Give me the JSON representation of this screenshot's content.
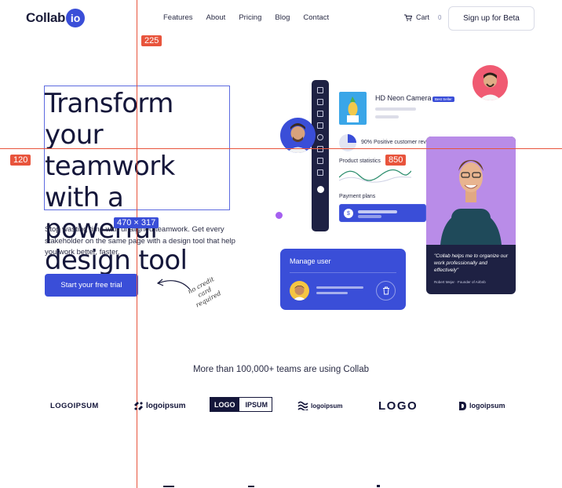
{
  "brand": {
    "name": "Collab",
    "badge": "io",
    "accent": "#3a4ed8"
  },
  "nav": {
    "items": [
      "Features",
      "About",
      "Pricing",
      "Blog",
      "Contact"
    ]
  },
  "cart": {
    "label": "Cart",
    "count": "0"
  },
  "signup_label": "Sign up for Beta",
  "guides": {
    "x_label": "225",
    "y_label": "120",
    "size_label": "470 × 317",
    "chart_label": "850"
  },
  "hero": {
    "title": "Transform your teamwork with a powerful design tool",
    "subtitle": "Stop wasting time with unaligned teamwork. Get every stakeholder on the same page with a design tool that help you work better, faster.",
    "cta": "Start your free trial",
    "note": "no credit card required"
  },
  "product": {
    "title": "HD Neon Camera",
    "badge": "Best Seller",
    "positive": "90% Positive customer rev",
    "stats": "Product statistics",
    "payment": "Payment plans",
    "payment_icon": "$"
  },
  "testimonial": {
    "quote": "\"Collab helps me to organize our work professionally and effectively\"",
    "author": "Robert Mejar",
    "role": "Founder of Airbnb"
  },
  "manage": {
    "title": "Manage user"
  },
  "trusted": "More than 100,000+ teams are using Collab",
  "logos": {
    "l1": "LOGOIPSUM",
    "l2": "logoipsum",
    "l3a": "LOGO",
    "l3b": "IPSUM",
    "l4": "logoipsum",
    "l5": "LOGO",
    "l6": "logoipsum"
  }
}
